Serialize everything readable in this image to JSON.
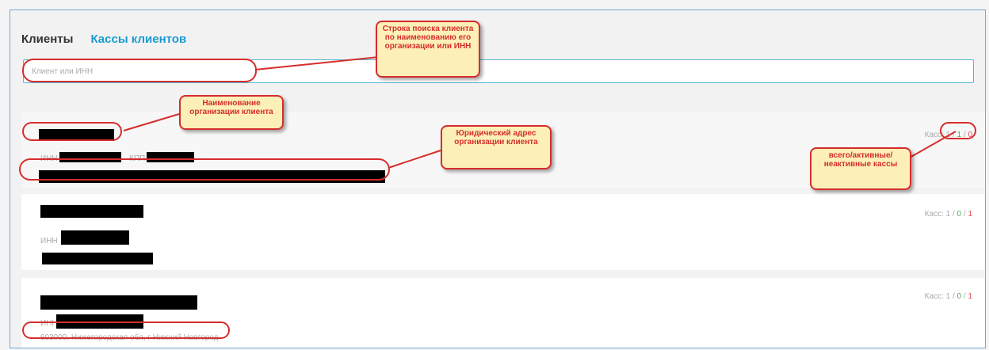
{
  "tabs": [
    "Клиенты",
    "Кассы клиентов"
  ],
  "search": {
    "placeholder": "Клиент или ИНН"
  },
  "labels": {
    "inn": "ИНН",
    "kpp": "КПП",
    "kass": "Касс:"
  },
  "clients": [
    {
      "counts": {
        "total": "1",
        "active": "1",
        "inactive": "0"
      },
      "has_kpp": true,
      "address": ""
    },
    {
      "counts": {
        "total": "1",
        "active": "0",
        "inactive": "1"
      },
      "has_kpp": false,
      "address": ""
    },
    {
      "counts": {
        "total": "1",
        "active": "0",
        "inactive": "1"
      },
      "has_kpp": false,
      "address": "603000, Нижегородская обл, г Нижний Новгород"
    }
  ],
  "callouts": {
    "search": "Строка поиска клиента по наименованию его организации или ИНН",
    "name": "Наименование организации клиента",
    "address": "Юридический адрес организации клиента",
    "kass": "всего/активные/ неактивные кассы"
  },
  "colors": {
    "accent": "#1a9bd0",
    "active": "#4caf50",
    "inactive": "#e05050",
    "callout_border": "#d62d2d",
    "callout_fill": "#fcefb8"
  }
}
